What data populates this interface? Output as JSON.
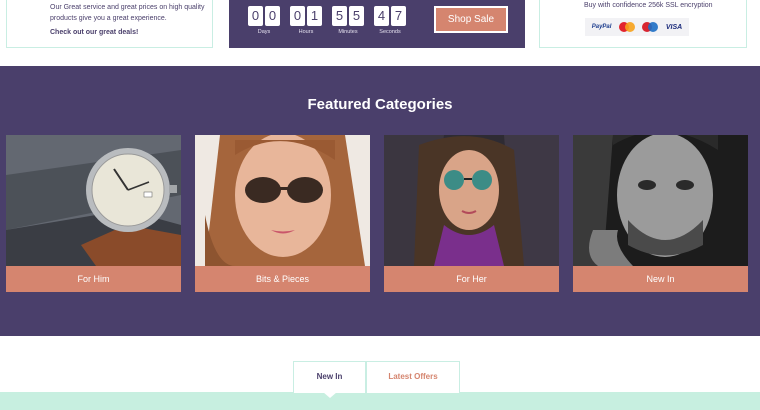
{
  "promo": {
    "left": {
      "description": "Our Great service and great prices on high quality products give you a great experience.",
      "cta": "Check out our great deals!"
    },
    "countdown": {
      "units": [
        {
          "digits": [
            "0",
            "0"
          ],
          "label": "Days"
        },
        {
          "digits": [
            "0",
            "1"
          ],
          "label": "Hours"
        },
        {
          "digits": [
            "5",
            "5"
          ],
          "label": "Minutes"
        },
        {
          "digits": [
            "4",
            "7"
          ],
          "label": "Seconds"
        }
      ],
      "shop_sale_label": "Shop Sale"
    },
    "right": {
      "ssl_text": "Buy with confidence 256k SSL encryption",
      "payment_icons": {
        "paypal": "PayPal",
        "mastercard": "mastercard-icon",
        "maestro": "maestro-icon",
        "visa": "VISA"
      }
    }
  },
  "featured": {
    "title": "Featured Categories",
    "categories": [
      {
        "label": "For Him",
        "image": "watch-photo"
      },
      {
        "label": "Bits & Pieces",
        "image": "woman-sunglasses-photo"
      },
      {
        "label": "For Her",
        "image": "woman-round-sunglasses-photo"
      },
      {
        "label": "New In",
        "image": "man-portrait-photo"
      }
    ]
  },
  "tabs": {
    "items": [
      {
        "label": "New In",
        "active": true
      },
      {
        "label": "Latest Offers",
        "active": false
      }
    ]
  },
  "colors": {
    "brand_purple": "#4a3f6b",
    "accent_salmon": "#d5856f",
    "mint": "#c7efe0"
  }
}
